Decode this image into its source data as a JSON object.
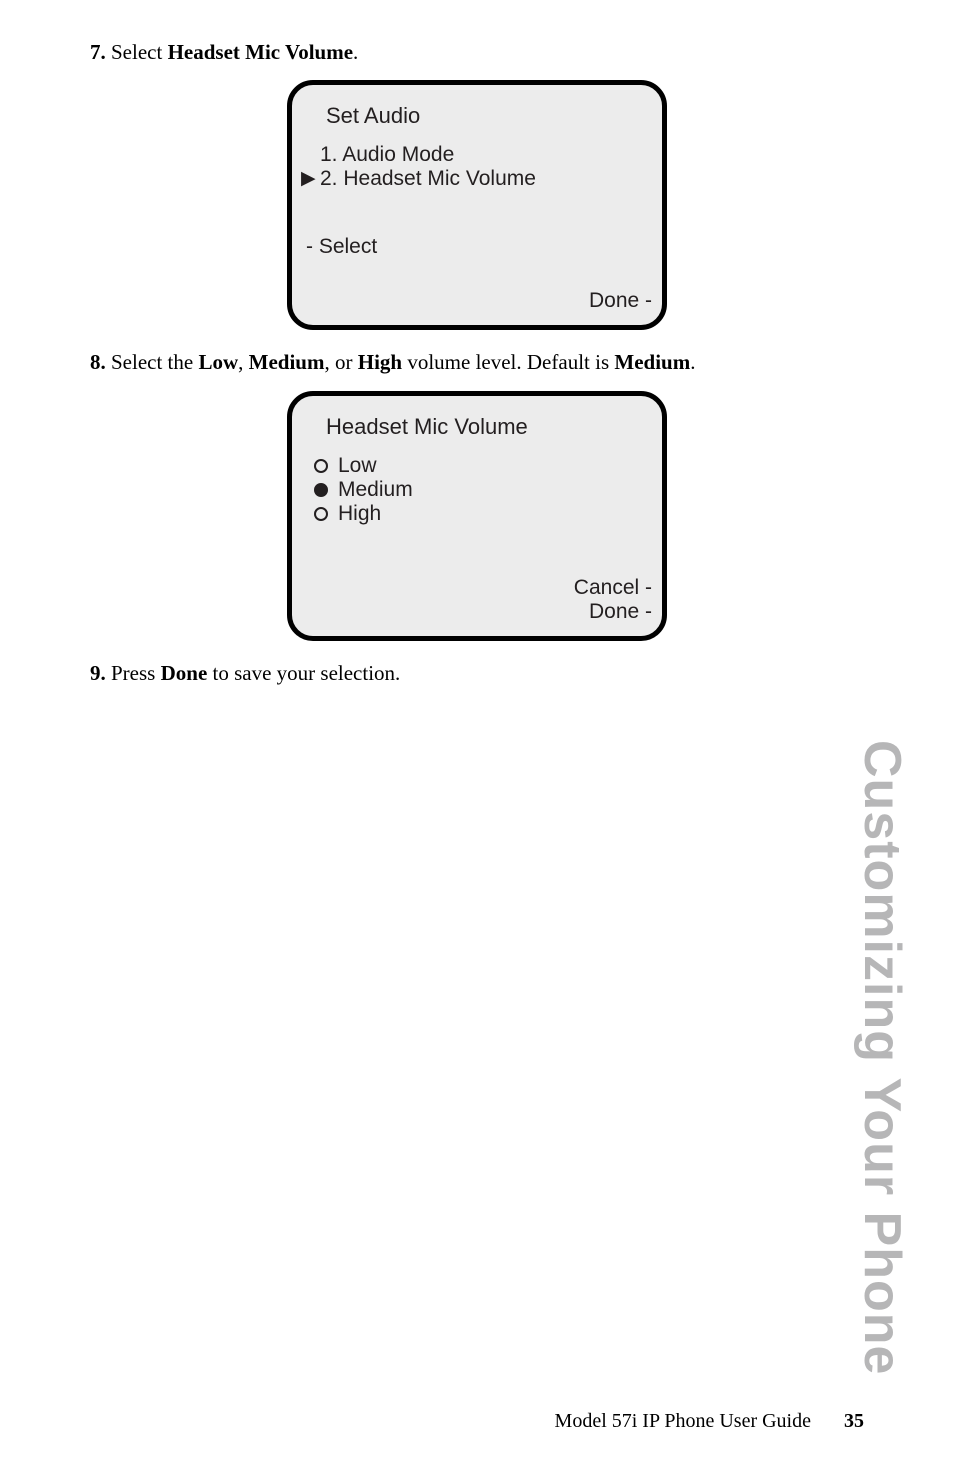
{
  "steps": {
    "s7_num": "7.",
    "s7_text_before": "Select ",
    "s7_bold": "Headset Mic Volume",
    "s7_text_after": ".",
    "s8_num": "8.",
    "s8_a": "Select the ",
    "s8_b1": "Low",
    "s8_c1": ", ",
    "s8_b2": "Medium",
    "s8_c2": ", or ",
    "s8_b3": "High",
    "s8_c3": " volume level. Default is ",
    "s8_b4": "Medium",
    "s8_c4": ".",
    "s9_num": "9.",
    "s9_a": "Press ",
    "s9_b": "Done",
    "s9_c": " to save your selection."
  },
  "screen1": {
    "title": "Set Audio",
    "item1": "1. Audio Mode",
    "item2": "2. Headset Mic Volume",
    "cursor": "▶",
    "select": "- Select",
    "done": "Done -"
  },
  "screen2": {
    "title": "Headset Mic Volume",
    "low": "Low",
    "medium": "Medium",
    "high": "High",
    "cancel": "Cancel -",
    "done": "Done -"
  },
  "side_title": "Customizing Your Phone",
  "footer_text": "Model 57i IP Phone User Guide",
  "page_number": "35"
}
